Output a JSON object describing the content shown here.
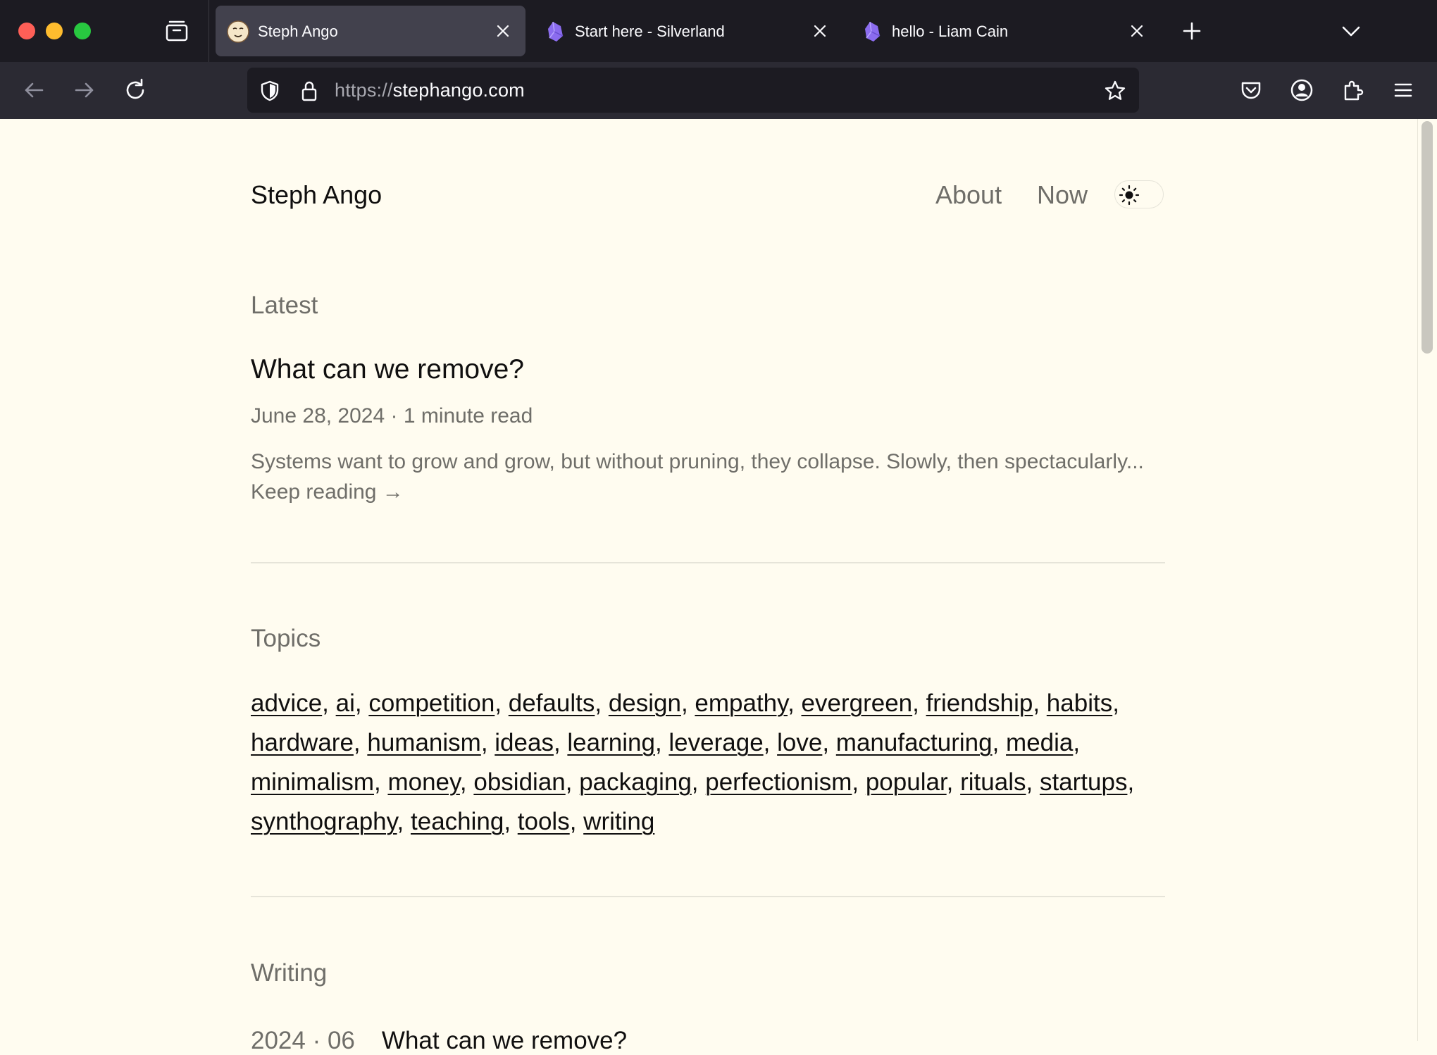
{
  "browser": {
    "tabs": [
      {
        "title": "Steph Ango",
        "active": true
      },
      {
        "title": "Start here - Silverland",
        "active": false
      },
      {
        "title": "hello - Liam Cain",
        "active": false
      }
    ],
    "url": {
      "scheme": "https://",
      "host": "stephango.com"
    }
  },
  "site": {
    "title": "Steph Ango",
    "nav": {
      "about": "About",
      "now": "Now"
    }
  },
  "latest": {
    "heading": "Latest",
    "post_title": "What can we remove?",
    "meta": "June 28, 2024 · 1 minute read",
    "excerpt": "Systems want to grow and grow, but without pruning, they collapse. Slowly, then spectacularly... ",
    "keep_reading": "Keep reading →"
  },
  "topics": {
    "heading": "Topics",
    "items": [
      "advice",
      "ai",
      "competition",
      "defaults",
      "design",
      "empathy",
      "evergreen",
      "friendship",
      "habits",
      "hardware",
      "humanism",
      "ideas",
      "learning",
      "leverage",
      "love",
      "manufacturing",
      "media",
      "minimalism",
      "money",
      "obsidian",
      "packaging",
      "perfectionism",
      "popular",
      "rituals",
      "startups",
      "synthography",
      "teaching",
      "tools",
      "writing"
    ]
  },
  "writing": {
    "heading": "Writing",
    "first_date": "2024 · 06",
    "first_title": "What can we remove?"
  }
}
